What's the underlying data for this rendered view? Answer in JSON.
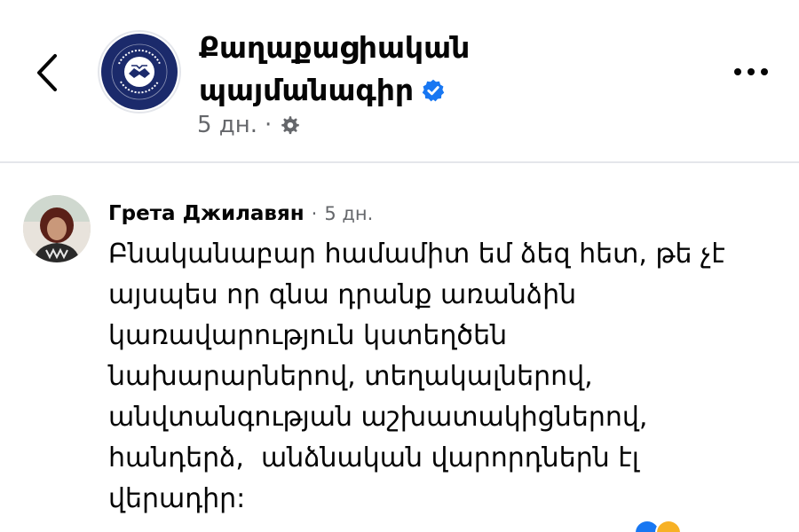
{
  "header": {
    "page_name_line1": "Քաղաքացիական",
    "page_name_line2": "պայմանագիր",
    "verified_icon": "verified-badge-icon",
    "meta_time": "5 дн.",
    "meta_separator": "·",
    "meta_privacy_icon": "gear-icon"
  },
  "comment": {
    "author": "Грета Джилавян",
    "separator": "·",
    "time": "5 дн.",
    "lines": [
      "Բնականաբար համամիտ եմ ձեզ հետ, թե չէ",
      "այսպես որ գնա դրանք առանձին",
      "կառավարություն կստեղծեն",
      "նախարարներով, տեղակալներով,",
      "անվտանգության աշխատակիցներով,",
      "հանդերձ,  անձնական վարորդներն էլ",
      "վերադիր:"
    ]
  },
  "colors": {
    "text_primary": "#050505",
    "text_secondary": "#65676b",
    "verified_blue": "#1877f2",
    "logo_navy": "#1b2a6b",
    "divider": "#e4e6eb"
  }
}
